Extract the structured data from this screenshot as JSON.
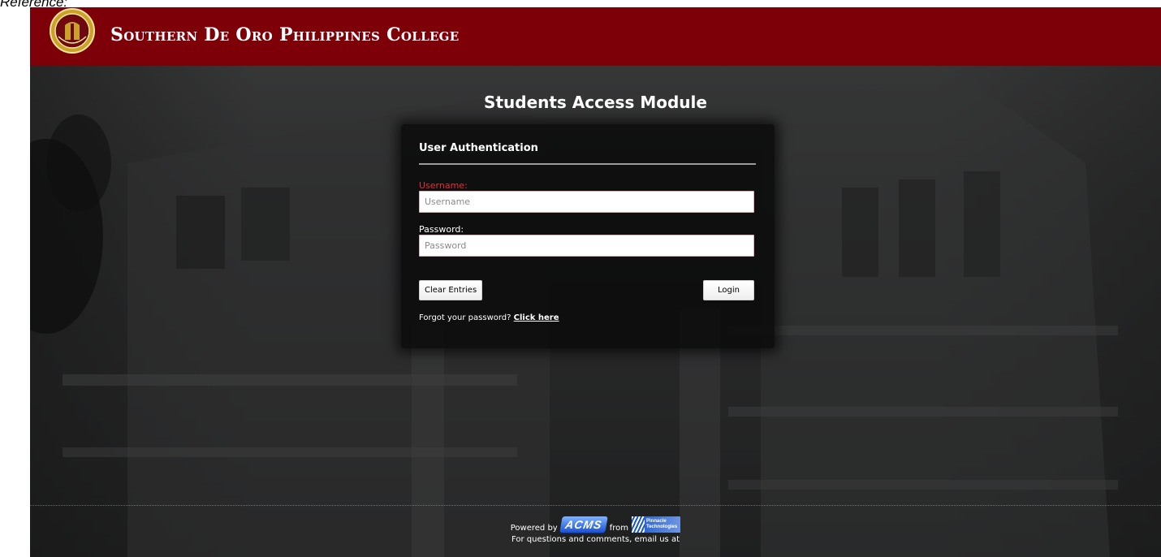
{
  "page": {
    "corner_label": "Reference:"
  },
  "header": {
    "college_name": "Southern De Oro Philippines College",
    "logo_icon": "college-seal-icon",
    "background_color": "#7d0009"
  },
  "main": {
    "module_title": "Students Access Module",
    "panel_title": "User Authentication",
    "username_label": "Username:",
    "username_placeholder": "Username",
    "username_value": "",
    "password_label": "Password:",
    "password_placeholder": "Password",
    "password_value": "",
    "clear_button": "Clear Entries",
    "login_button": "Login",
    "forgot_prefix": "Forgot your password?",
    "forgot_link": "Click here",
    "error_label_color": "#e0303a"
  },
  "footer": {
    "powered_by": "Powered by",
    "acms_logo_text": "ACMS",
    "from": "from",
    "pinnacle_line1": "Pinnacle",
    "pinnacle_line2": "Technologies",
    "contact_text": "For questions and comments, email us at",
    "acms_logo_icon": "acms-logo-icon",
    "pinnacle_logo_icon": "pinnacle-technologies-logo-icon"
  }
}
